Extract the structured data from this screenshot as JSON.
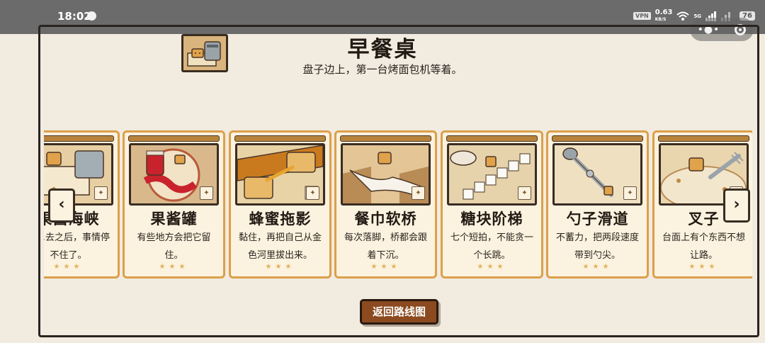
{
  "status_bar": {
    "time": "18:02",
    "vpn": "VPN",
    "speed_value": "0.63",
    "speed_unit": "KB/S",
    "network": "5G",
    "battery": "76"
  },
  "level_header": {
    "title": "早餐桌",
    "subtitle": "盘子边上，第一台烤面包机等着。",
    "thumb_icon": "toaster-icon"
  },
  "cards": [
    {
      "title": "果酱海峡",
      "desc": "……去之后，事情停不住了。",
      "stars": "★★★",
      "icon": "toast-tray-icon"
    },
    {
      "title": "果酱罐",
      "desc": "有些地方会把它留住。",
      "stars": "★★★",
      "icon": "jam-jar-icon"
    },
    {
      "title": "蜂蜜拖影",
      "desc": "黏住，再把自己从金色河里拔出来。",
      "stars": "★★★",
      "icon": "honey-icon"
    },
    {
      "title": "餐巾软桥",
      "desc": "每次落脚，桥都会跟着下沉。",
      "stars": "★★★",
      "icon": "napkin-icon"
    },
    {
      "title": "糖块阶梯",
      "desc": "七个短拍，不能贪一个长跳。",
      "stars": "★★★",
      "icon": "sugar-cube-icon"
    },
    {
      "title": "勺子滑道",
      "desc": "不蓄力，把两段速度带到勺尖。",
      "stars": "★★★",
      "icon": "spoon-icon"
    },
    {
      "title": "叉子",
      "desc": "台面上有个东西不想让路。",
      "stars": "★★★",
      "icon": "fork-icon"
    }
  ],
  "nav": {
    "prev": "‹",
    "next": "›"
  },
  "back_button": "返回路线图",
  "colors": {
    "background": "#f1ebe0",
    "card_border": "#dca04a",
    "card_bg": "#fbf2df",
    "star": "#e2b35b",
    "button": "#8b4a1f"
  }
}
